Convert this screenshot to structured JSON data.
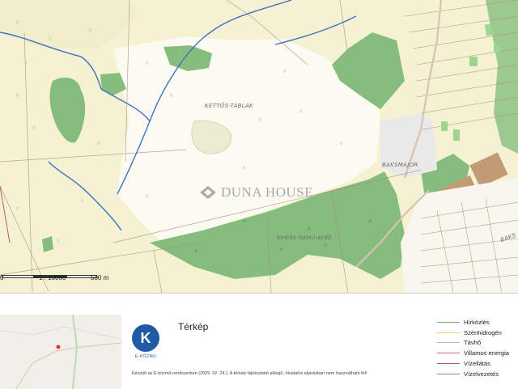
{
  "map": {
    "labels": {
      "locality_1": "KETTŐS-TÁBLÁK",
      "locality_2": "Kettős-halmi-erdő",
      "locality_3": "BAKSMAJOR",
      "locality_4": "BAKS"
    },
    "watermark": "DUNA HOUSE",
    "scale": {
      "start": "0",
      "ratio": "1 : 10000",
      "end": "500 m"
    }
  },
  "footer": {
    "logo_letter": "K",
    "logo_caption": "E-KÖZMŰ",
    "title": "Térkép",
    "footnote": "Készült az E-közmű rendszerben (2025. 02. 24.). A térkép tájékoztató jellegű, hivatalos eljárásban nem használható fel!",
    "legend": [
      {
        "label": "Hírközlés",
        "color": "#7aa874"
      },
      {
        "label": "Szénhidrogén",
        "color": "#e4d86a"
      },
      {
        "label": "Távhő",
        "color": "#b9b9b9"
      },
      {
        "label": "Villamos energia",
        "color": "#c76f6f"
      },
      {
        "label": "Vízellátás",
        "color": "#9b5c8f"
      },
      {
        "label": "Vízelvezetés",
        "color": "#a37e6c"
      }
    ]
  },
  "colors": {
    "field": "#f7f4d6",
    "forest": "#86bc7e",
    "field_white": "#fbfbf2",
    "water": "#3e72c7",
    "parcel": "#b08a7a"
  },
  "icons": {
    "watermark": "duna-house-logo-icon",
    "minimap_marker": "location-marker-icon"
  }
}
